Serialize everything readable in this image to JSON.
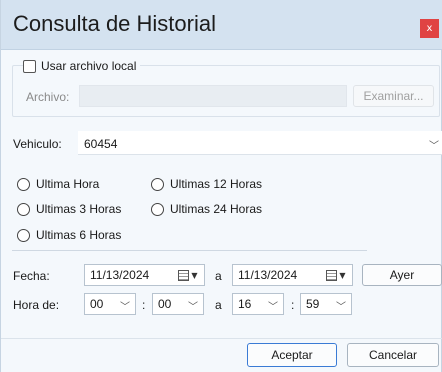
{
  "window": {
    "title": "Consulta de Historial",
    "close_glyph": "x"
  },
  "local_file": {
    "checkbox_label": "Usar archivo local",
    "checked": false,
    "archivo_label": "Archivo:",
    "archivo_value": "",
    "browse_label": "Examinar..."
  },
  "vehicle": {
    "label": "Vehiculo:",
    "value": "60454"
  },
  "time_ranges": [
    {
      "label": "Ultima Hora",
      "selected": false
    },
    {
      "label": "Ultimas 12 Horas",
      "selected": false
    },
    {
      "label": "Ultimas 3 Horas",
      "selected": false
    },
    {
      "label": "Ultimas 24 Horas",
      "selected": false
    },
    {
      "label": "Ultimas 6 Horas",
      "selected": false
    }
  ],
  "date": {
    "label": "Fecha:",
    "from": "11/13/2024",
    "separator": "a",
    "to": "11/13/2024",
    "yesterday_label": "Ayer"
  },
  "time": {
    "label": "Hora de:",
    "from_hour": "00",
    "from_minute": "00",
    "separator": "a",
    "to_hour": "16",
    "to_minute": "59",
    "colon": ":"
  },
  "actions": {
    "accept_label": "Aceptar",
    "cancel_label": "Cancelar"
  },
  "colors": {
    "titlebar": "#d4e2f0",
    "close": "#e04343",
    "accent_border": "#3a7bd5",
    "body_bg": "#f4f8fc"
  },
  "icons": [
    "close-icon",
    "calendar-icon",
    "dropdown-arrow-icon",
    "chevron-down-icon"
  ]
}
